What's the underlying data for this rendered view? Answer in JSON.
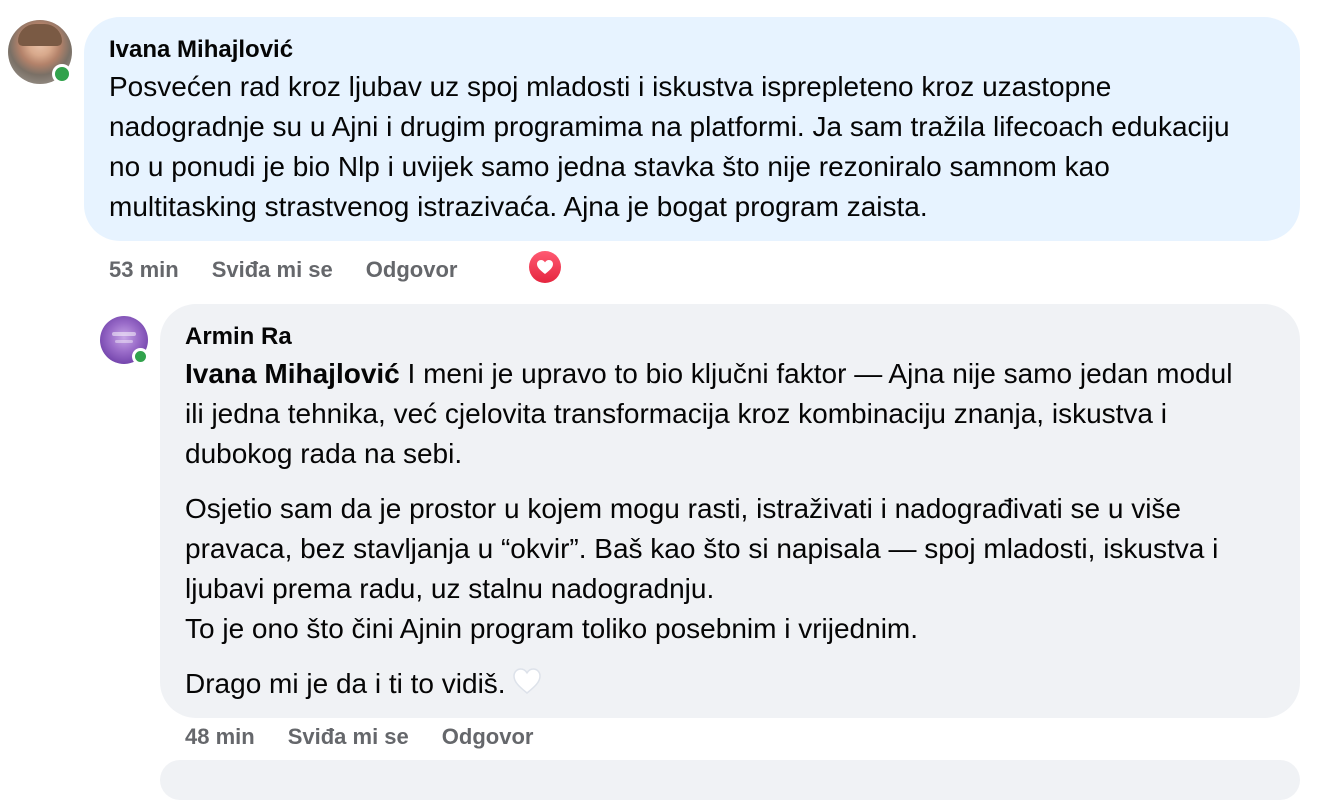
{
  "comment1": {
    "author": "Ivana Mihajlović",
    "text": "Posvećen rad kroz ljubav uz spoj mladosti i iskustva isprepleteno kroz uzastopne nadogradnje su u Ajni i drugim programima na platformi. Ja sam tražila lifecoach edukaciju no u ponudi je bio Nlp i uvijek samo jedna stavka što nije rezoniralo samnom kao multitasking strastvenog istrazivaća. Ajna je bogat program zaista.",
    "time": "53 min",
    "like_label": "Sviđa mi se",
    "reply_label": "Odgovor",
    "reaction": "heart",
    "bubble_color": "#e7f3ff"
  },
  "comment2": {
    "author": "Armin Ra",
    "mention": "Ivana Mihajlović",
    "para1": "I meni je upravo to bio ključni faktor — Ajna nije samo jedan modul ili jedna tehnika, već cjelovita transformacija kroz kombinaciju znanja, iskustva i dubokog rada na sebi.",
    "para2_line1": "Osjetio sam da je prostor u kojem mogu rasti, istraživati i nadograđivati se u više pravaca, bez stavljanja u “okvir”. Baš kao što si napisala — spoj mladosti, iskustva i ljubavi prema radu, uz stalnu nadogradnju.",
    "para2_line2": "To je ono što čini Ajnin program toliko posebnim i vrijednim.",
    "para3": "Drago mi je da i ti to vidiš.",
    "emoji": "white-heart",
    "time": "48 min",
    "like_label": "Sviđa mi se",
    "reply_label": "Odgovor",
    "bubble_color": "#f0f2f5",
    "avatar_color": "#7b4bb3"
  },
  "colors": {
    "online": "#31a24c",
    "meta_text": "#65676b",
    "reaction_red": "#e5263f"
  }
}
